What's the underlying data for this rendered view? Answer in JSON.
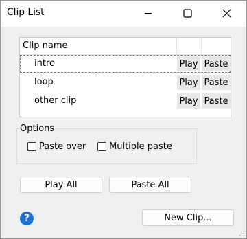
{
  "window": {
    "title": "Clip List"
  },
  "titlebar": {
    "minimize_icon": "minimize-icon",
    "maximize_icon": "maximize-icon",
    "close_icon": "close-icon"
  },
  "clip_table": {
    "header": "Clip name",
    "rows": [
      {
        "name": "intro",
        "play": "Play",
        "paste": "Paste",
        "selected": true
      },
      {
        "name": "loop",
        "play": "Play",
        "paste": "Paste",
        "selected": false
      },
      {
        "name": "other clip",
        "play": "Play",
        "paste": "Paste",
        "selected": false
      }
    ]
  },
  "options": {
    "label": "Options",
    "paste_over": {
      "label": "Paste over",
      "checked": false
    },
    "multiple_paste": {
      "label": "Multiple paste",
      "checked": false
    }
  },
  "buttons": {
    "play_all": "Play All",
    "paste_all": "Paste All",
    "new_clip": "New Clip..."
  },
  "help": {
    "glyph": "?",
    "icon": "help-icon"
  },
  "colors": {
    "help_blue": "#1f73d8",
    "cell_button_bg": "#e8e8e8"
  }
}
